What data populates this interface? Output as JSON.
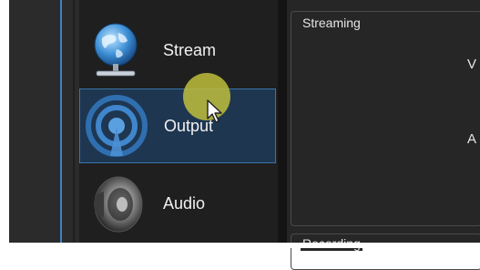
{
  "sidebar": {
    "items": [
      {
        "label": "Stream",
        "icon": "globe-network-icon",
        "selected": false
      },
      {
        "label": "Output",
        "icon": "broadcast-icon",
        "selected": true
      },
      {
        "label": "Audio",
        "icon": "speaker-icon",
        "selected": false
      }
    ]
  },
  "main": {
    "groups": [
      {
        "title": "Streaming"
      },
      {
        "title": "Recording"
      }
    ],
    "clipped_labels": [
      "V",
      "A"
    ]
  },
  "colors": {
    "selection_bg": "#1e3650",
    "selection_border": "#3a74a8",
    "cursor_highlight": "#bebe3c"
  }
}
